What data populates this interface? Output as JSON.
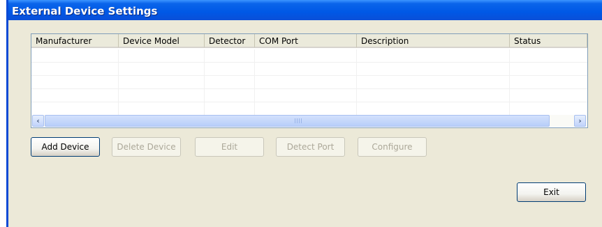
{
  "window": {
    "title": "External Device Settings"
  },
  "table": {
    "columns": [
      "Manufacturer",
      "Device Model",
      "Detector",
      "COM Port",
      "Description",
      "Status"
    ],
    "rows": []
  },
  "scrollbar": {
    "left_icon": "scroll-left-arrow",
    "right_icon": "scroll-right-arrow",
    "left_glyph": "‹",
    "right_glyph": "›"
  },
  "buttons": {
    "add_device": "Add Device",
    "delete_device": "Delete Device",
    "edit": "Edit",
    "detect_port": "Detect Port",
    "configure": "Configure",
    "exit": "Exit"
  },
  "colors": {
    "titlebar": "#0058e6",
    "window_bg": "#ece9d8",
    "disabled_text": "#aca899"
  }
}
